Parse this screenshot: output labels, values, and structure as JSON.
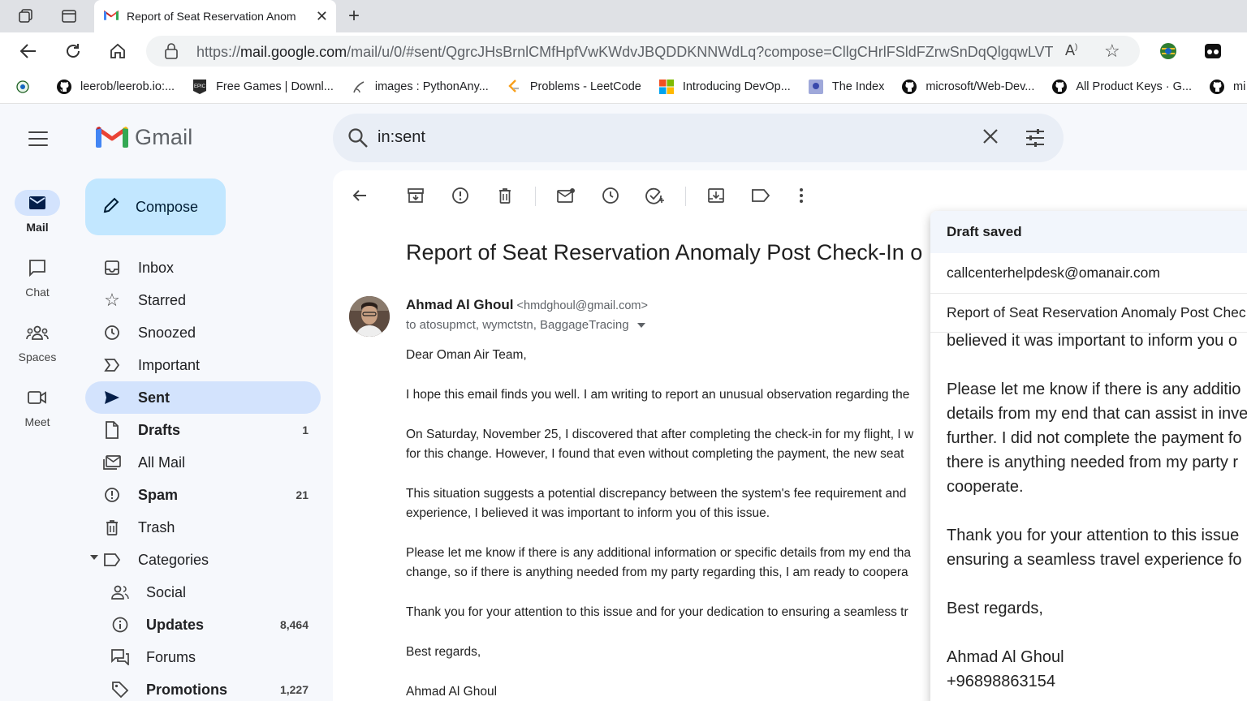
{
  "browser": {
    "tab_title": "Report of Seat Reservation Anom",
    "url_prefix": "https://",
    "url_domain": "mail.google.com",
    "url_path": "/mail/u/0/#sent/QgrcJHsBrnlCMfHpfVwKWdvJBQDDKNNWdLq?compose=CllgCHrlFSldFZrwSnDqQlgqwLVTRtg...",
    "bookmarks": [
      {
        "label": "",
        "icon": "site-icon"
      },
      {
        "label": "leerob/leerob.io:...",
        "icon": "github-icon"
      },
      {
        "label": "Free Games | Downl...",
        "icon": "epic-icon"
      },
      {
        "label": "images : PythonAny...",
        "icon": "python-icon"
      },
      {
        "label": "Problems - LeetCode",
        "icon": "leetcode-icon"
      },
      {
        "label": "Introducing DevOp...",
        "icon": "microsoft-icon"
      },
      {
        "label": "The Index",
        "icon": "index-icon"
      },
      {
        "label": "microsoft/Web-Dev...",
        "icon": "github-icon"
      },
      {
        "label": "All Product Keys · G...",
        "icon": "github-icon"
      },
      {
        "label": "mi",
        "icon": "github-icon"
      }
    ]
  },
  "gmail": {
    "logo_text": "Gmail",
    "rail": [
      {
        "label": "Mail",
        "icon": "mail-icon",
        "active": true
      },
      {
        "label": "Chat",
        "icon": "chat-icon",
        "active": false
      },
      {
        "label": "Spaces",
        "icon": "spaces-icon",
        "active": false
      },
      {
        "label": "Meet",
        "icon": "meet-icon",
        "active": false
      }
    ],
    "compose_label": "Compose",
    "nav": [
      {
        "label": "Inbox",
        "count": ""
      },
      {
        "label": "Starred",
        "count": ""
      },
      {
        "label": "Snoozed",
        "count": ""
      },
      {
        "label": "Important",
        "count": ""
      },
      {
        "label": "Sent",
        "count": ""
      },
      {
        "label": "Drafts",
        "count": "1"
      },
      {
        "label": "All Mail",
        "count": ""
      },
      {
        "label": "Spam",
        "count": "21"
      },
      {
        "label": "Trash",
        "count": ""
      },
      {
        "label": "Categories",
        "count": ""
      },
      {
        "label": "Social",
        "count": ""
      },
      {
        "label": "Updates",
        "count": "8,464"
      },
      {
        "label": "Forums",
        "count": ""
      },
      {
        "label": "Promotions",
        "count": "1,227"
      }
    ],
    "search_value": "in:sent"
  },
  "email": {
    "subject": "Report of Seat Reservation Anomaly Post Check-In o",
    "sender_name": "Ahmad Al Ghoul",
    "sender_email": "<hmdghoul@gmail.com>",
    "recipients": "to atosupmct, wymctstn, BaggageTracing",
    "body": [
      "Dear Oman Air Team,",
      "I hope this email finds you well. I am writing to report an unusual observation regarding the",
      "On Saturday, November 25, I discovered that after completing the check-in for my flight, I w",
      "for this change. However, I found that even without completing the payment, the new seat",
      "This situation suggests a potential discrepancy between the system's fee requirement and",
      "experience, I believed it was important to inform you of this issue.",
      "Please let me know if there is any additional information or specific details from my end tha",
      "change, so if there is anything needed from my party regarding this, I am ready to coopera",
      "Thank you for your attention to this issue and for your dedication to ensuring a seamless tr",
      "Best regards,",
      "Ahmad Al Ghoul"
    ]
  },
  "draft": {
    "status": "Draft saved",
    "to": "callcenterhelpdesk@omanair.com",
    "subject": "Report of Seat Reservation Anomaly Post Chec",
    "body": [
      "believed it was important to inform you o",
      "",
      "Please let me know if there is any additio",
      "details from my end that can assist in inve",
      "further. I did not complete the payment fo",
      "there is anything needed from my party r",
      "cooperate.",
      "",
      "Thank you for your attention to this issue",
      "ensuring a seamless travel experience fo",
      "",
      "Best regards,",
      "",
      "Ahmad Al Ghoul",
      "+96898863154"
    ]
  },
  "colors": {
    "accent": "#0b57d0",
    "compose_bg": "#c2e7ff",
    "active_nav": "#d3e3fd",
    "search_bg": "#e9eef6"
  }
}
